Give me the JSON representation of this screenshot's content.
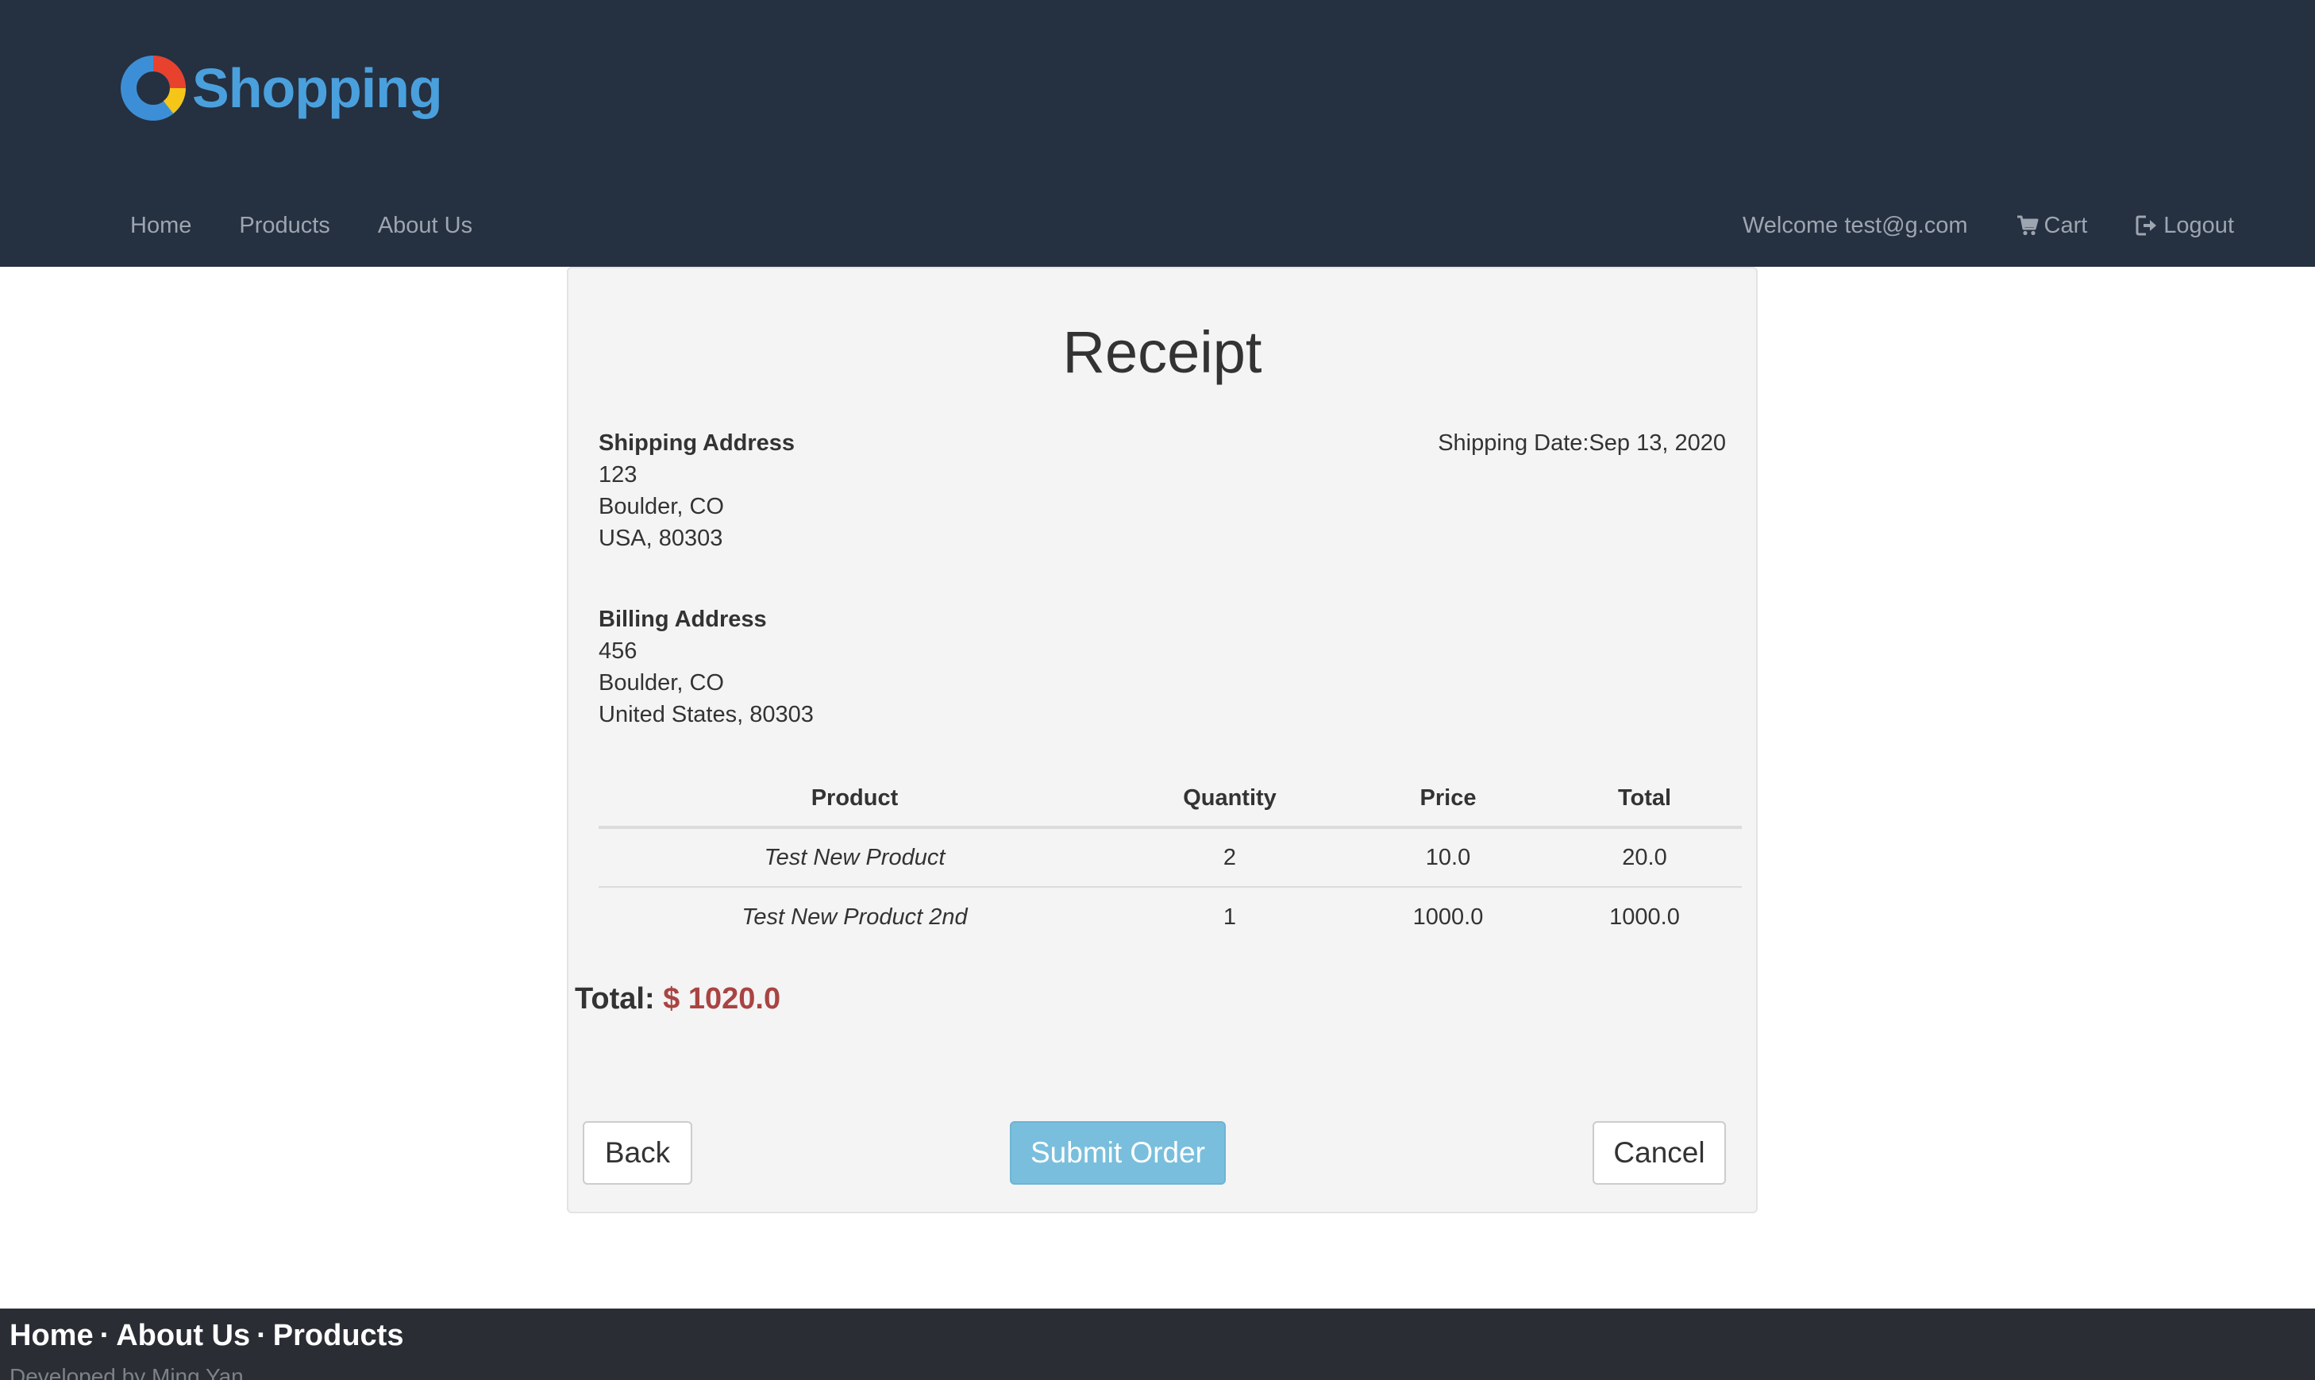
{
  "brand": {
    "name": "Shopping",
    "colors": {
      "ring_blue": "#3c8fd6",
      "ring_red": "#e8412e",
      "ring_yellow": "#f5c518",
      "text": "#4aa0dd"
    }
  },
  "nav": {
    "left": [
      {
        "label": "Home"
      },
      {
        "label": "Products"
      },
      {
        "label": "About Us"
      }
    ],
    "welcome": "Welcome test@g.com",
    "cart": {
      "label": "Cart",
      "icon": "cart-icon"
    },
    "logout": {
      "label": "Logout",
      "icon": "logout-icon"
    }
  },
  "receipt": {
    "title": "Receipt",
    "shipping": {
      "heading": "Shipping Address",
      "line1": "123",
      "line2": "Boulder, CO",
      "line3": "USA, 80303"
    },
    "shipping_date": {
      "label": "Shipping Date:",
      "value": "Sep 13, 2020"
    },
    "billing": {
      "heading": "Billing Address",
      "line1": "456",
      "line2": "Boulder, CO",
      "line3": "United States, 80303"
    },
    "table": {
      "headers": [
        "Product",
        "Quantity",
        "Price",
        "Total"
      ],
      "rows": [
        [
          "Test New Product",
          "2",
          "10.0",
          "20.0"
        ],
        [
          "Test New Product 2nd",
          "1",
          "1000.0",
          "1000.0"
        ]
      ]
    },
    "total": {
      "label": "Total:",
      "value": "$ 1020.0",
      "color": "#a94442"
    },
    "buttons": {
      "back": "Back",
      "submit": "Submit Order",
      "cancel": "Cancel"
    }
  },
  "footer": {
    "links": [
      "Home",
      "About Us",
      "Products"
    ],
    "separator": "·",
    "credit": "Developed by Ming Yan"
  }
}
